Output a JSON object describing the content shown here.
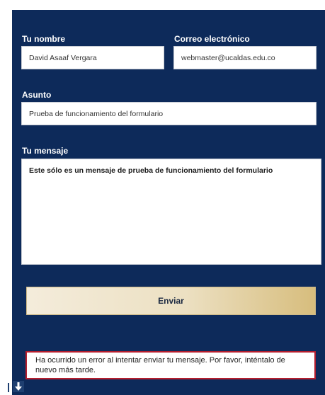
{
  "form": {
    "name_label": "Tu nombre",
    "name_value": "David Asaaf Vergara",
    "email_label": "Correo electrónico",
    "email_value": "webmaster@ucaldas.edu.co",
    "subject_label": "Asunto",
    "subject_value": "Prueba de funcionamiento del formulario",
    "message_label": "Tu mensaje",
    "message_value": "Este sólo es un mensaje de prueba de funcionamiento del formulario",
    "submit_label": "Enviar"
  },
  "error_message": "Ha ocurrido un error al intentar enviar tu mensaje. Por favor, inténtalo de nuevo más tarde.",
  "colors": {
    "panel_bg": "#0d2a5a",
    "button_gold": "#d7bd7d",
    "error_border": "#b41e2e"
  },
  "icons": {
    "scroll_down": "arrow-down-icon"
  }
}
